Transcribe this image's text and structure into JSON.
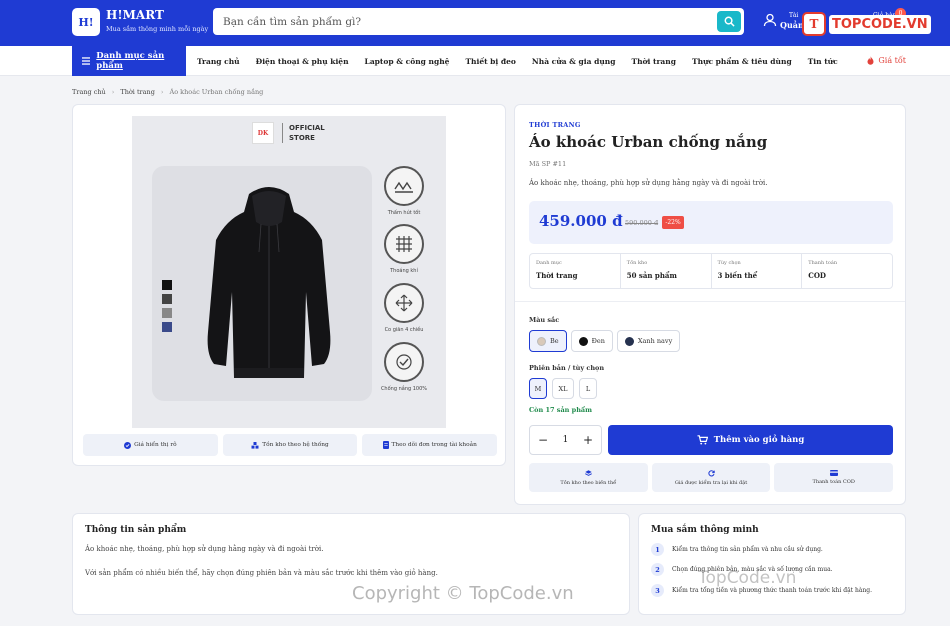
{
  "header": {
    "logo_text": "H!",
    "brand": "H!MART",
    "tagline": "Mua sắm thông minh mỗi ngày",
    "search_placeholder": "Bạn cần tìm sản phẩm gì?",
    "account_small": "Tài",
    "account_big": "Quản",
    "cart_label": "Giỏ hàng",
    "cart_count": "0",
    "watermark_logo": "TOPCODE.VN",
    "colors": {
      "primary": "#1f3bd3",
      "search_button": "#19b8c9"
    }
  },
  "nav": {
    "category_button": "Danh mục sản phẩm",
    "links": [
      "Trang chủ",
      "Điện thoại & phụ kiện",
      "Laptop & công nghệ",
      "Thiết bị đeo",
      "Nhà cửa & gia dụng",
      "Thời trang",
      "Thực phẩm & tiêu dùng",
      "Tin tức"
    ],
    "deal": "Giá tốt"
  },
  "breadcrumb": [
    "Trang chủ",
    "Thời trang",
    "Áo khoác Urban chống nắng"
  ],
  "image": {
    "store_logo": "DK",
    "store_line1": "OFFICIAL",
    "store_line2": "STORE",
    "features": [
      "Thấm hút tốt",
      "Thoáng khí",
      "Co giãn 4 chiều",
      "Chống nắng 100%"
    ],
    "swatches": [
      "#111111",
      "#444444",
      "#888888",
      "#3a4a8a"
    ],
    "badges": [
      "Giá hiển thị rõ",
      "Tồn kho theo hệ thống",
      "Theo dõi đơn trong tài khoản"
    ]
  },
  "product": {
    "category": "THỜI TRANG",
    "title": "Áo khoác Urban chống nắng",
    "sku": "Mã SP #11",
    "short_desc": "Áo khoác nhẹ, thoáng, phù hợp sử dụng hằng ngày và đi ngoài trời.",
    "price": "459.000 đ",
    "old_price": "590.000 đ",
    "discount": "-22%",
    "stats": [
      {
        "label": "Danh mục",
        "value": "Thời trang"
      },
      {
        "label": "Tồn kho",
        "value": "50 sản phẩm"
      },
      {
        "label": "Tùy chọn",
        "value": "3 biến thể"
      },
      {
        "label": "Thanh toán",
        "value": "COD"
      }
    ],
    "color_label": "Màu sắc",
    "colors": [
      {
        "name": "Be",
        "hex": "#d9c9b9",
        "active": true
      },
      {
        "name": "Đen",
        "hex": "#111111",
        "active": false
      },
      {
        "name": "Xanh navy",
        "hex": "#26324f",
        "active": false
      }
    ],
    "size_label": "Phiên bản / tùy chọn",
    "sizes": [
      {
        "name": "M",
        "active": true
      },
      {
        "name": "XL",
        "active": false
      },
      {
        "name": "L",
        "active": false
      }
    ],
    "stock": "Còn 17 sản phẩm",
    "quantity": "1",
    "add_to_cart": "Thêm vào giỏ hàng",
    "perks": [
      "Tồn kho theo biến thể",
      "Giá được kiểm tra lại khi đặt",
      "Thanh toán COD"
    ]
  },
  "description": {
    "title": "Thông tin sản phẩm",
    "p1": "Áo khoác nhẹ, thoáng, phù hợp sử dụng hằng ngày và đi ngoài trời.",
    "p2": "Với sản phẩm có nhiều biến thể, hãy chọn đúng phiên bản và màu sắc trước khi thêm vào giỏ hàng."
  },
  "tips": {
    "title": "Mua sắm thông minh",
    "items": [
      "Kiểm tra thông tin sản phẩm và nhu cầu sử dụng.",
      "Chọn đúng phiên bản, màu sắc và số lượng cần mua.",
      "Kiểm tra tổng tiền và phương thức thanh toán trước khi đặt hàng."
    ]
  },
  "watermark": {
    "mid": "TopCode.vn",
    "bottom": "Copyright © TopCode.vn"
  }
}
